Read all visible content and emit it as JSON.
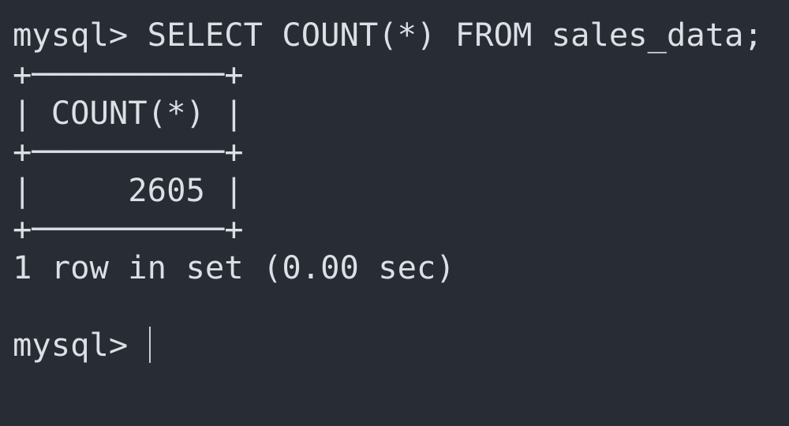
{
  "terminal": {
    "lines": [
      "mysql> SELECT COUNT(*) FROM sales_data;",
      "+──────────+",
      "| COUNT(*) |",
      "+──────────+",
      "|     2605 |",
      "+──────────+",
      "1 row in set (0.00 sec)",
      "",
      "mysql> "
    ]
  },
  "colors": {
    "background": "#282c34",
    "text": "#dcdfe4",
    "cursor": "#dcdfe4"
  }
}
